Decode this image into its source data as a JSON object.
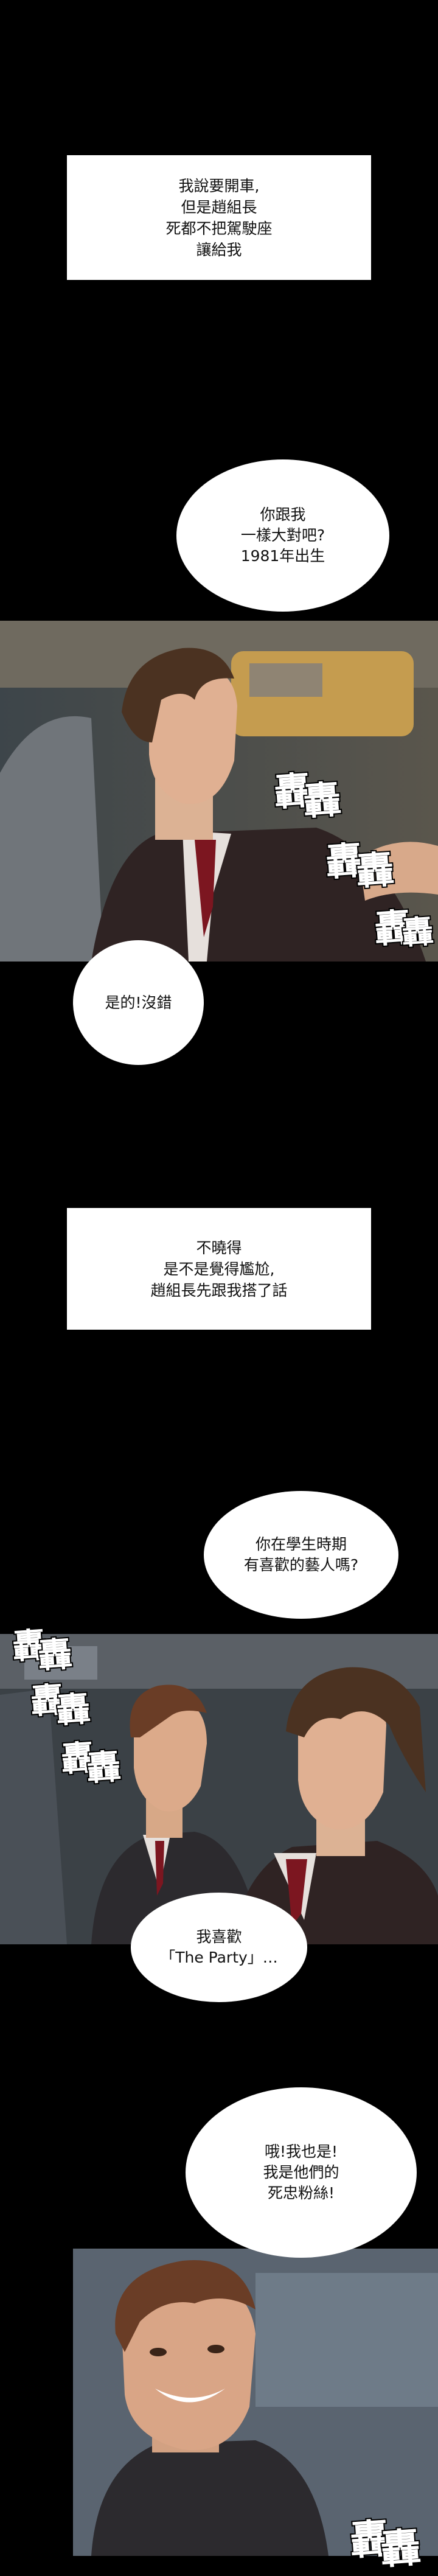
{
  "captions": {
    "c1": [
      "我說要開車,",
      "但是趙組長",
      "死都不把駕駛座",
      "讓給我"
    ],
    "c2": [
      "不曉得",
      "是不是覺得尷尬,",
      "趙組長先跟我搭了話"
    ]
  },
  "bubbles": {
    "b1": [
      "你跟我",
      "一樣大對吧?",
      "1981年出生"
    ],
    "b2": [
      "是的!沒錯"
    ],
    "b3": [
      "你在學生時期",
      "有喜歡的藝人嗎?"
    ],
    "b4": [
      "我喜歡",
      "「The Party」…"
    ],
    "b5": [
      "哦!我也是!",
      "我是他們的",
      "死忠粉絲!"
    ]
  },
  "sfx": {
    "rumble": "轟"
  },
  "colors": {
    "background": "#000000",
    "panel_bg": "#3a4046",
    "suit": "#2f2323",
    "tie": "#7c1620",
    "hair": "#4b3221",
    "skin": "#e0b092"
  }
}
